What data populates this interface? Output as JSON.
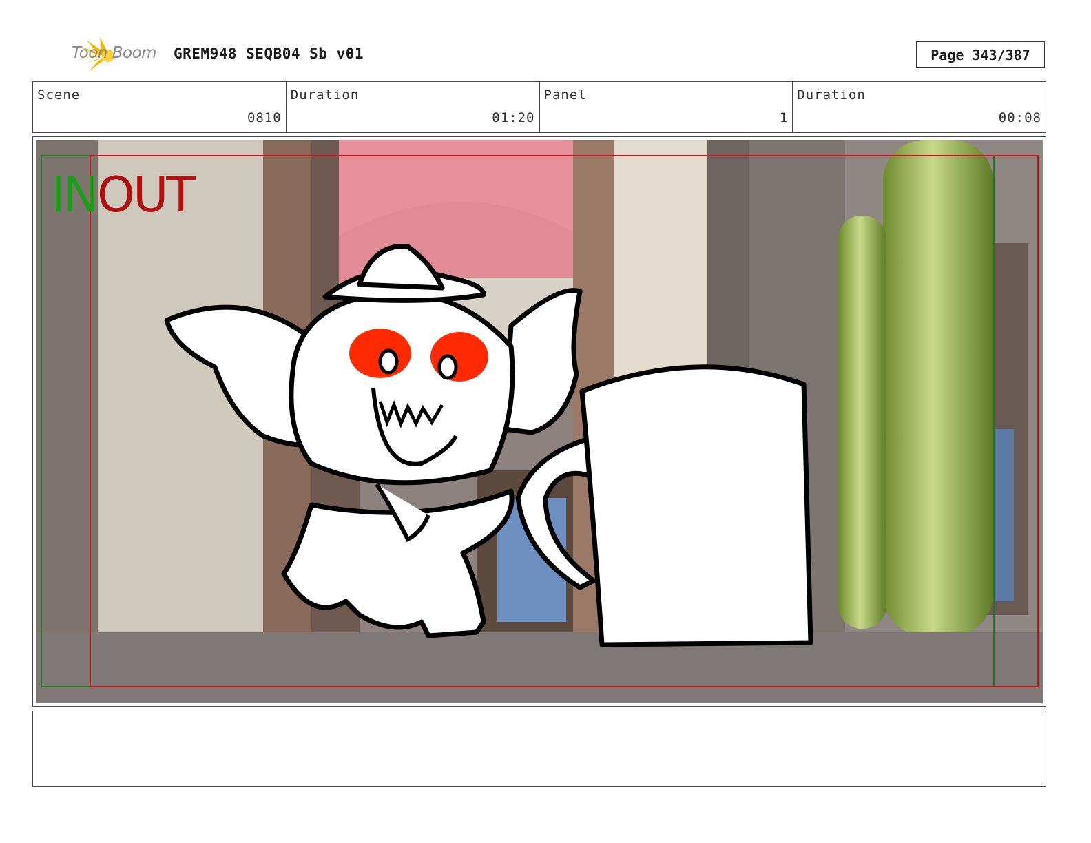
{
  "header": {
    "logo_text": "Toon Boom",
    "logo_icon": "starburst-icon",
    "title": "GREM948 SEQB04 Sb v01",
    "page": "Page 343/387"
  },
  "info": [
    {
      "label": "Scene",
      "value": "0810"
    },
    {
      "label": "Duration",
      "value": "01:20"
    },
    {
      "label": "Panel",
      "value": "1"
    },
    {
      "label": "Duration",
      "value": "00:08"
    }
  ],
  "overlay": {
    "in_label": "IN",
    "out_label": "OUT",
    "in_color": "#1a9e1a",
    "out_color": "#b01010"
  },
  "notes": {
    "text": ""
  }
}
